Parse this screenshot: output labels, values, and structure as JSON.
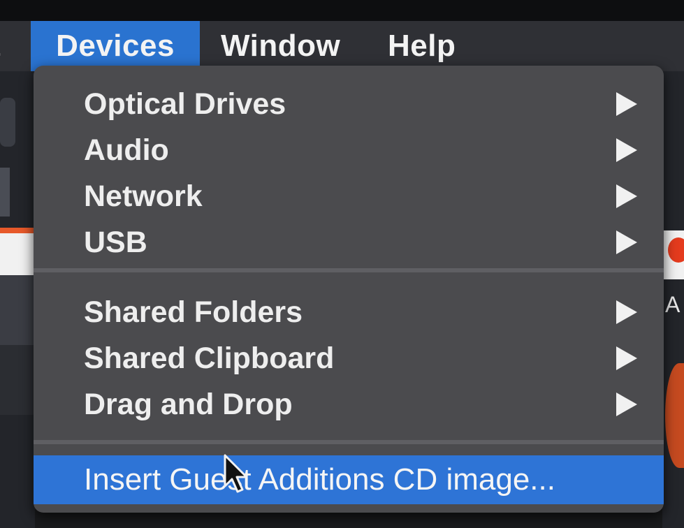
{
  "menubar": {
    "edit_fragment": "t",
    "devices": "Devices",
    "window": "Window",
    "help": "Help"
  },
  "devices_menu": {
    "items": [
      {
        "label": "Optical Drives",
        "has_submenu": true
      },
      {
        "label": "Audio",
        "has_submenu": true
      },
      {
        "label": "Network",
        "has_submenu": true
      },
      {
        "label": "USB",
        "has_submenu": true
      },
      {
        "label": "Shared Folders",
        "has_submenu": true
      },
      {
        "label": "Shared Clipboard",
        "has_submenu": true
      },
      {
        "label": "Drag and Drop",
        "has_submenu": true
      },
      {
        "label": "Insert Guest Additions CD image...",
        "has_submenu": false,
        "highlighted": true
      }
    ]
  },
  "background": {
    "right_fragment": "A"
  },
  "colors": {
    "menubar_bg": "#2f3035",
    "active_menu": "#2a73d0",
    "dropdown_bg": "#4b4b4e",
    "highlight_row": "#2e74d6"
  }
}
